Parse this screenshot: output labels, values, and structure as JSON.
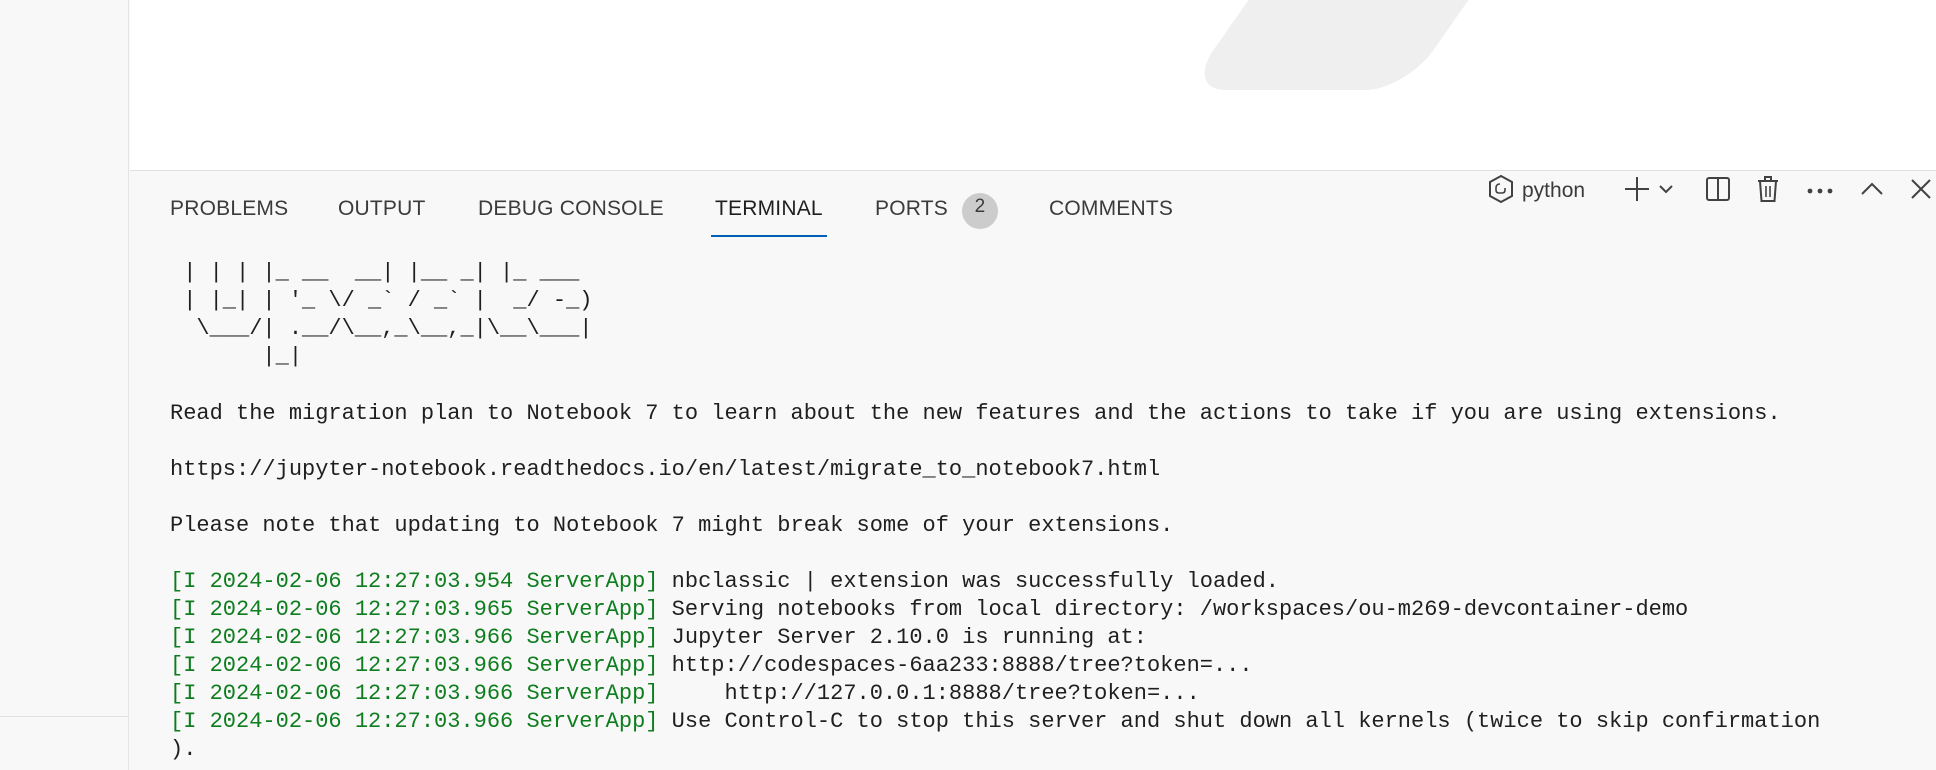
{
  "panel": {
    "tabs": [
      {
        "label": "PROBLEMS",
        "active": false
      },
      {
        "label": "OUTPUT",
        "active": false
      },
      {
        "label": "DEBUG CONSOLE",
        "active": false
      },
      {
        "label": "TERMINAL",
        "active": true
      },
      {
        "label": "PORTS",
        "active": false,
        "badge": "2"
      },
      {
        "label": "COMMENTS",
        "active": false
      }
    ],
    "actions": {
      "terminal_profile": "python",
      "icons": [
        "terminal-python-icon",
        "add-icon",
        "chevron-down-icon",
        "split-terminal-icon",
        "trash-icon",
        "more-actions-icon",
        "maximize-panel-icon",
        "close-icon"
      ]
    }
  },
  "terminal": {
    "ascii_art": [
      " | | | |_ __  __| |__ _| |_ ___",
      " | |_| | '_ \\/ _` / _` |  _/ -_)",
      "  \\___/| .__/\\__,_\\__,_|\\__\\___|",
      "       |_|"
    ],
    "messages": [
      "Read the migration plan to Notebook 7 to learn about the new features and the actions to take if you are using extensions.",
      "https://jupyter-notebook.readthedocs.io/en/latest/migrate_to_notebook7.html",
      "Please note that updating to Notebook 7 might break some of your extensions."
    ],
    "log": [
      {
        "prefix": "[I 2024-02-06 12:27:03.954 ServerApp]",
        "text": " nbclassic | extension was successfully loaded."
      },
      {
        "prefix": "[I 2024-02-06 12:27:03.965 ServerApp]",
        "text": " Serving notebooks from local directory: /workspaces/ou-m269-devcontainer-demo"
      },
      {
        "prefix": "[I 2024-02-06 12:27:03.966 ServerApp]",
        "text": " Jupyter Server 2.10.0 is running at:"
      },
      {
        "prefix": "[I 2024-02-06 12:27:03.966 ServerApp]",
        "text": " http://codespaces-6aa233:8888/tree?token=..."
      },
      {
        "prefix": "[I 2024-02-06 12:27:03.966 ServerApp]",
        "text": "     http://127.0.0.1:8888/tree?token=..."
      },
      {
        "prefix": "[I 2024-02-06 12:27:03.966 ServerApp]",
        "text": " Use Control-C to stop this server and shut down all kernels (twice to skip confirmation"
      }
    ],
    "wrap_line": ")."
  }
}
